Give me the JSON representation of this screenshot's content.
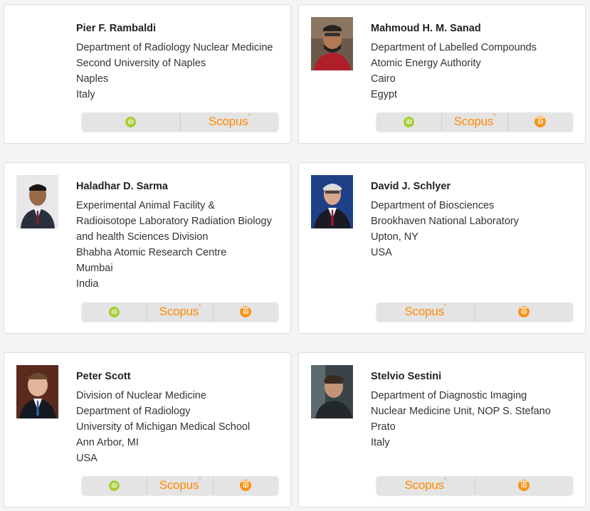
{
  "people": [
    {
      "name": "Pier F. Rambaldi",
      "affiliation": [
        "Department of Radiology Nuclear Medicine",
        "Second University of Naples",
        "Naples",
        "Italy"
      ],
      "has_photo": false,
      "links": [
        "orcid",
        "scopus"
      ]
    },
    {
      "name": "Mahmoud H. M. Sanad",
      "affiliation": [
        "Department of Labelled Compounds",
        "Atomic Energy Authority",
        "Cairo",
        "Egypt"
      ],
      "has_photo": true,
      "links": [
        "orcid",
        "scopus",
        "publons"
      ]
    },
    {
      "name": "Haladhar D. Sarma",
      "affiliation": [
        "Experimental Animal Facility &",
        "Radioisotope Laboratory Radiation Biology",
        "and health Sciences Division",
        "Bhabha Atomic Research Centre",
        "Mumbai",
        "India"
      ],
      "has_photo": true,
      "links": [
        "orcid",
        "scopus",
        "publons"
      ]
    },
    {
      "name": "David J. Schlyer",
      "affiliation": [
        "Department of Biosciences",
        "Brookhaven National Laboratory",
        "Upton, NY",
        "USA"
      ],
      "has_photo": true,
      "links": [
        "scopus",
        "publons"
      ]
    },
    {
      "name": "Peter Scott",
      "affiliation": [
        "Division of Nuclear Medicine",
        "Department of Radiology",
        "University of Michigan Medical School",
        "Ann Arbor, MI",
        "USA"
      ],
      "has_photo": true,
      "links": [
        "orcid",
        "scopus",
        "publons"
      ]
    },
    {
      "name": "Stelvio Sestini",
      "affiliation": [
        "Department of Diagnostic Imaging",
        "Nuclear Medicine Unit, NOP S. Stefano",
        "Prato",
        "Italy"
      ],
      "has_photo": true,
      "links": [
        "scopus",
        "publons"
      ]
    }
  ],
  "labels": {
    "orcid": "iD",
    "scopus": "Scopus",
    "publons": "iD"
  },
  "colors": {
    "orcid": "#a6ce39",
    "scopus": "#ff8a00",
    "publons": "#f7941d"
  }
}
